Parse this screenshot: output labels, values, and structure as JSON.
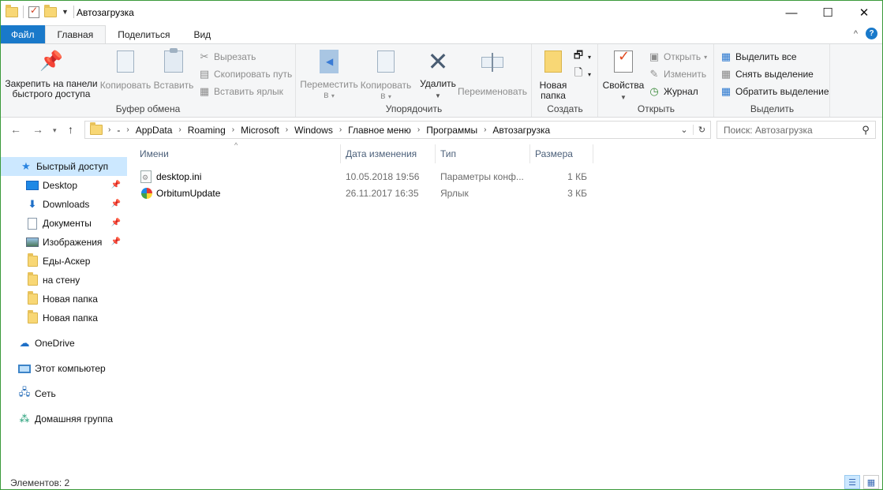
{
  "window": {
    "title": "Автозагрузка",
    "minimize": "—",
    "maximize": "☐",
    "close": "✕"
  },
  "tabs": [
    {
      "label": "Файл"
    },
    {
      "label": "Главная"
    },
    {
      "label": "Поделиться"
    },
    {
      "label": "Вид"
    }
  ],
  "ribbon": {
    "clipboard": {
      "label": "Буфер обмена",
      "pin_line1": "Закрепить на панели",
      "pin_line2": "быстрого доступа",
      "copy": "Копировать",
      "paste": "Вставить",
      "cut": "Вырезать",
      "copy_path": "Скопировать путь",
      "paste_shortcut": "Вставить ярлык"
    },
    "organize": {
      "label": "Упорядочить",
      "move_line1": "Переместить",
      "move_line2": "в",
      "copy_line1": "Копировать",
      "copy_line2": "в",
      "delete": "Удалить",
      "rename": "Переименовать"
    },
    "create": {
      "label": "Создать",
      "new_folder_line1": "Новая",
      "new_folder_line2": "папка"
    },
    "open": {
      "label": "Открыть",
      "properties": "Свойства",
      "open": "Открыть",
      "edit": "Изменить",
      "history": "Журнал"
    },
    "select": {
      "label": "Выделить",
      "select_all": "Выделить все",
      "select_none": "Снять выделение",
      "invert": "Обратить выделение"
    }
  },
  "address": {
    "ellipsis": "-",
    "crumbs": [
      "AppData",
      "Roaming",
      "Microsoft",
      "Windows",
      "Главное меню",
      "Программы",
      "Автозагрузка"
    ]
  },
  "search": {
    "placeholder": "Поиск: Автозагрузка"
  },
  "nav": {
    "quick_access": "Быстрый доступ",
    "items": [
      {
        "label": "Desktop",
        "pinned": true
      },
      {
        "label": "Downloads",
        "pinned": true
      },
      {
        "label": "Документы",
        "pinned": true
      },
      {
        "label": "Изображения",
        "pinned": true
      },
      {
        "label": "Еды-Аскер",
        "pinned": false
      },
      {
        "label": "на стену",
        "pinned": false
      },
      {
        "label": "Новая папка",
        "pinned": false
      },
      {
        "label": "Новая папка",
        "pinned": false
      }
    ],
    "onedrive": "OneDrive",
    "this_pc": "Этот компьютер",
    "network": "Сеть",
    "homegroup": "Домашняя группа"
  },
  "columns": {
    "name": "Имени",
    "date": "Дата изменения",
    "type": "Тип",
    "size": "Размера"
  },
  "files": [
    {
      "name": "desktop.ini",
      "date": "10.05.2018 19:56",
      "type": "Параметры конф...",
      "size": "1 КБ",
      "icon": "ini-file-icon"
    },
    {
      "name": "OrbitumUpdate",
      "date": "26.11.2017 16:35",
      "type": "Ярлык",
      "size": "3 КБ",
      "icon": "orbitum-shortcut-icon"
    }
  ],
  "status": {
    "items": "Элементов: 2"
  }
}
